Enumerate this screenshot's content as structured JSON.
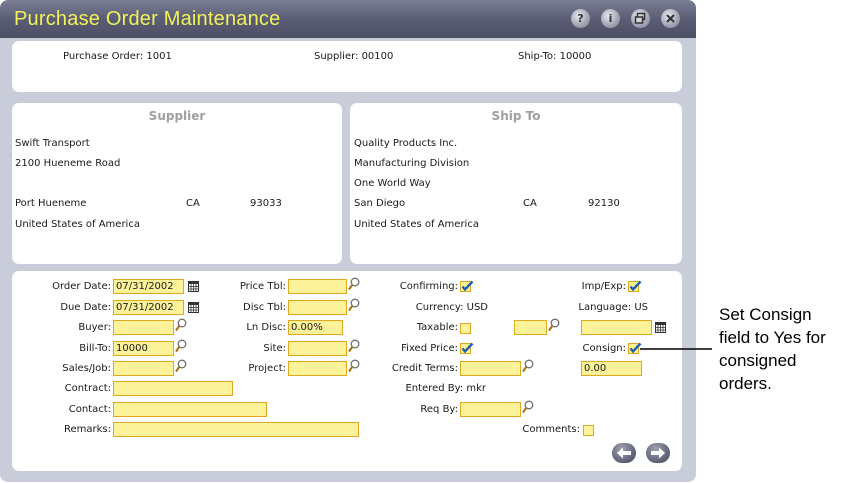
{
  "window": {
    "title": "Purchase Order Maintenance",
    "controls": [
      "help-icon",
      "info-icon",
      "restore-icon",
      "close-icon"
    ]
  },
  "header": {
    "purchase_order": "Purchase Order: 1001",
    "supplier": "Supplier: 00100",
    "ship_to": "Ship-To: 10000"
  },
  "supplier_panel": {
    "title": "Supplier",
    "name": "Swift Transport",
    "address1": "2100 Hueneme Road",
    "city": "Port Hueneme",
    "state": "CA",
    "zip": "93033",
    "country": "United States of America"
  },
  "shipto_panel": {
    "title": "Ship To",
    "name": "Quality Products Inc.",
    "address1": "Manufacturing Division",
    "address2": "One World Way",
    "city": "San Diego",
    "state": "CA",
    "zip": "92130",
    "country": "United States of America"
  },
  "form": {
    "order_date_label": "Order Date:",
    "order_date": "07/31/2002",
    "due_date_label": "Due Date:",
    "due_date": "07/31/2002",
    "buyer_label": "Buyer:",
    "buyer": "",
    "bill_to_label": "Bill-To:",
    "bill_to": "10000",
    "sales_job_label": "Sales/Job:",
    "sales_job": "",
    "contract_label": "Contract:",
    "contract": "",
    "contact_label": "Contact:",
    "contact": "",
    "remarks_label": "Remarks:",
    "remarks": "",
    "price_tbl_label": "Price Tbl:",
    "price_tbl": "",
    "disc_tbl_label": "Disc Tbl:",
    "disc_tbl": "",
    "ln_disc_label": "Ln Disc:",
    "ln_disc": "0.00%",
    "site_label": "Site:",
    "site": "",
    "project_label": "Project:",
    "project": "",
    "confirming_label": "Confirming:",
    "confirming": true,
    "currency_label": "Currency: USD",
    "taxable_label": "Taxable:",
    "taxable": false,
    "fixed_price_label": "Fixed Price:",
    "fixed_price": true,
    "credit_terms_label": "Credit Terms:",
    "credit_terms": "",
    "entered_by_label": "Entered By: mkr",
    "req_by_label": "Req By:",
    "req_by": "",
    "imp_exp_label": "Imp/Exp:",
    "imp_exp": true,
    "language_label": "Language: US",
    "tax_code": "",
    "tax_date": "",
    "consign_label": "Consign:",
    "consign": true,
    "consign_value": "0.00",
    "comments_label": "Comments:",
    "comments": false
  },
  "callout": {
    "line1": "Set Consign",
    "line2": "field to Yes for",
    "line3": "consigned",
    "line4": "orders."
  },
  "colors": {
    "title_text": "#f2f25a",
    "field_bg": "#fcf29a",
    "field_border": "#e0a820",
    "window_bg": "#c9ccd9",
    "checkmark": "#1f5fb3"
  }
}
